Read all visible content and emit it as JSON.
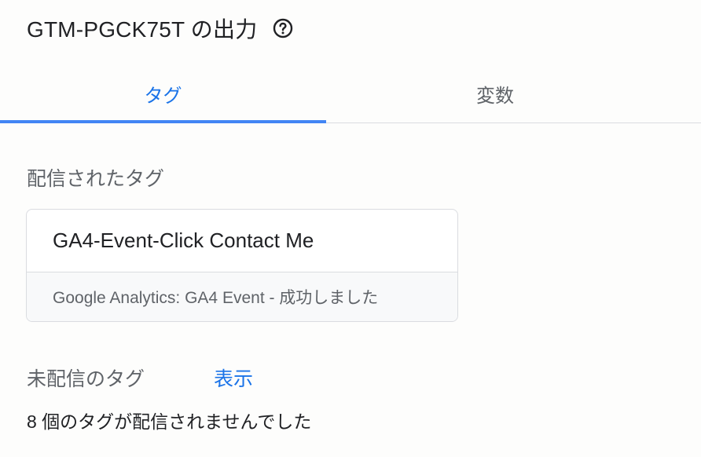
{
  "header": {
    "title": "GTM-PGCK75T の出力",
    "help_icon": "help-circle-icon"
  },
  "tabs": [
    {
      "label": "タグ",
      "active": true
    },
    {
      "label": "変数",
      "active": false
    }
  ],
  "fired_tags": {
    "section_title": "配信されたタグ",
    "items": [
      {
        "name": "GA4-Event-Click Contact Me",
        "status": "Google Analytics: GA4 Event - 成功しました"
      }
    ]
  },
  "not_fired_tags": {
    "section_title": "未配信のタグ",
    "show_link": "表示",
    "summary": "8 個のタグが配信されませんでした"
  },
  "colors": {
    "accent": "#1a73e8",
    "tab_indicator": "#4285f4",
    "muted_text": "#5f6368",
    "border": "#dadce0"
  }
}
